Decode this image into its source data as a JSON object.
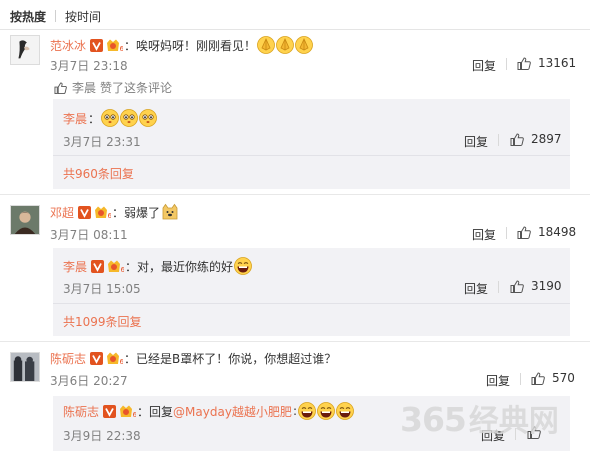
{
  "sort_bar": {
    "hot_label": "按热度",
    "time_label": "按时间"
  },
  "comments": [
    {
      "user": "范冰冰",
      "text": "唉呀妈呀！刚刚看见！",
      "emojis": [
        "pray-emoji",
        "pray-emoji",
        "pray-emoji"
      ],
      "time": "3月7日 23:18",
      "reply_label": "回复",
      "likes": "13161",
      "liked_by": {
        "user": "李晨",
        "text": "赞了这条评论"
      },
      "sub": {
        "user": "李晨",
        "text": "",
        "emojis": [
          "shy-emoji",
          "shy-emoji",
          "shy-emoji"
        ],
        "time": "3月7日 23:31",
        "reply_label": "回复",
        "likes": "2897"
      },
      "more_replies": "共960条回复"
    },
    {
      "user": "邓超",
      "text": "弱爆了",
      "emojis": [
        "doge-emoji"
      ],
      "time": "3月7日 08:11",
      "reply_label": "回复",
      "likes": "18498",
      "sub": {
        "user": "李晨",
        "text": "对，最近你练的好",
        "emojis": [
          "laugh-emoji"
        ],
        "time": "3月7日 15:05",
        "reply_label": "回复",
        "likes": "3190"
      },
      "more_replies": "共1099条回复"
    },
    {
      "user": "陈砺志",
      "text": "已经是B罩杯了！你说，你想超过谁？",
      "time": "3月6日 20:27",
      "reply_label": "回复",
      "likes": "570",
      "sub": {
        "user": "陈砺志",
        "text_prefix": "回复",
        "mention": "@Mayday越越小肥肥",
        "emojis": [
          "laugh-emoji",
          "laugh-emoji",
          "laugh-emoji"
        ],
        "time": "3月9日 22:38",
        "reply_label": "回复",
        "likes": ""
      }
    }
  ],
  "watermark": {
    "digits": "365",
    "chinese": "经典网"
  },
  "colors": {
    "link": "#eb7350",
    "muted": "#808080",
    "subbox_bg": "#f2f2f5"
  }
}
